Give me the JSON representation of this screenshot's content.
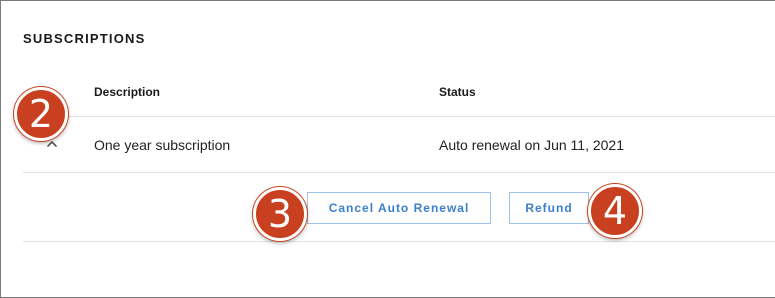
{
  "section": {
    "title": "SUBSCRIPTIONS"
  },
  "table": {
    "headers": {
      "description": "Description",
      "status": "Status"
    },
    "rows": [
      {
        "description": "One year subscription",
        "status": "Auto renewal on Jun 11, 2021",
        "expander_icon": "chevron-up-icon"
      }
    ]
  },
  "actions": {
    "cancel_auto_renewal": "Cancel Auto Renewal",
    "refund": "Refund"
  },
  "callouts": {
    "expand_row": "2",
    "cancel_auto_renewal": "3",
    "refund": "4"
  },
  "colors": {
    "accent": "#3c7fcc",
    "button_border": "#9ec3ea",
    "callout": "#c8401f"
  }
}
